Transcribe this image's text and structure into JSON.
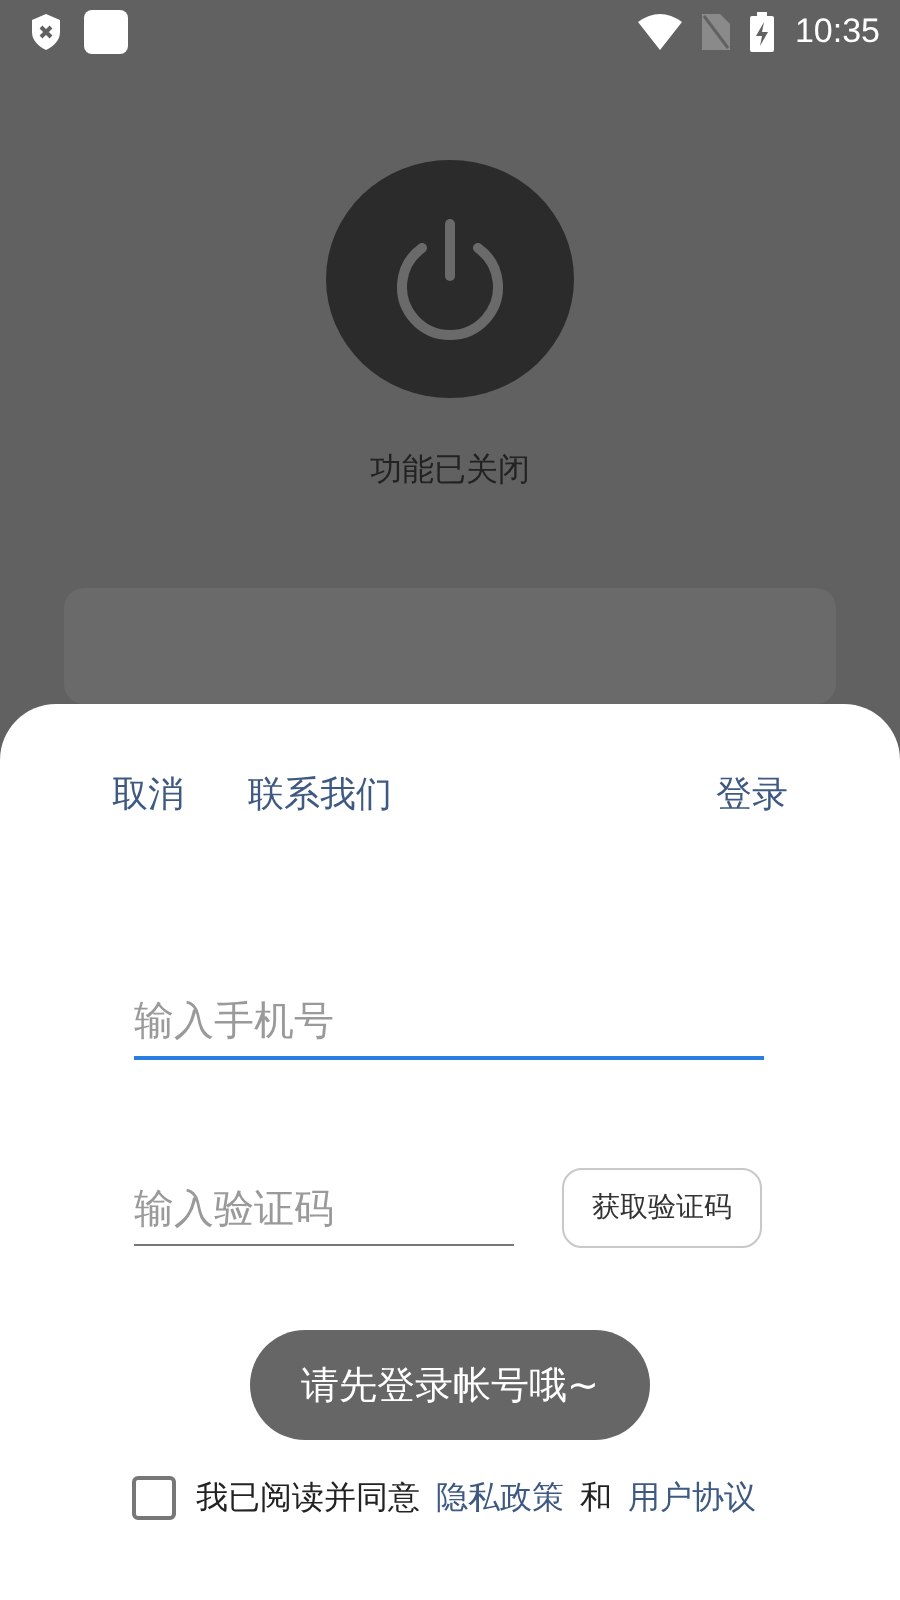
{
  "status_bar": {
    "time": "10:35"
  },
  "power": {
    "on": false,
    "label": "功能已关闭"
  },
  "sheet": {
    "nav": [
      {
        "kind": "action",
        "label": "取消"
      },
      {
        "kind": "action",
        "label": "联系我们"
      },
      {
        "kind": "primary",
        "label": "登录"
      }
    ],
    "phone_field": {
      "placeholder": "输入手机号",
      "focused": true
    },
    "code_field": {
      "placeholder": "输入验证码",
      "focused": false
    },
    "code_button": "获取验证码",
    "agreement": {
      "checked": false,
      "text": "我已阅读并同意",
      "privacy_link": "隐私政策",
      "joiner": "和",
      "terms_link": "用户协议"
    }
  },
  "toast": "请先登录帐号哦~"
}
